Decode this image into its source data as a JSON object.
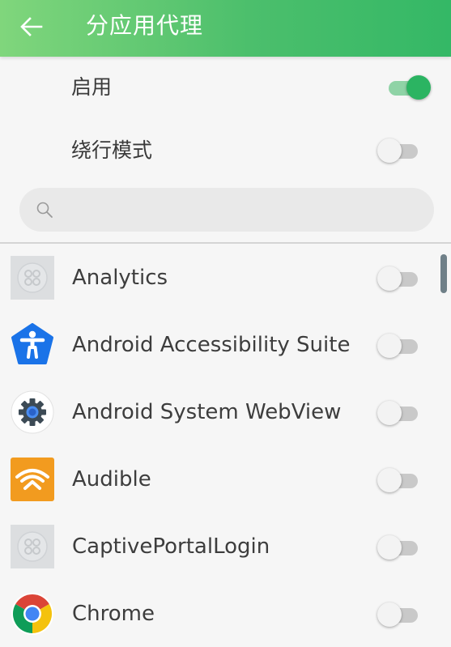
{
  "header": {
    "title": "分应用代理"
  },
  "settings": {
    "enable_label": "启用",
    "enable_on": true,
    "bypass_label": "绕行模式",
    "bypass_on": false
  },
  "search": {
    "placeholder": "",
    "value": ""
  },
  "apps": [
    {
      "name": "Analytics",
      "icon": "placeholder-app-icon",
      "enabled": false
    },
    {
      "name": "Android Accessibility Suite",
      "icon": "accessibility-icon",
      "enabled": false
    },
    {
      "name": "Android System WebView",
      "icon": "webview-gear-icon",
      "enabled": false
    },
    {
      "name": "Audible",
      "icon": "audible-icon",
      "enabled": false
    },
    {
      "name": "CaptivePortalLogin",
      "icon": "placeholder-app-icon",
      "enabled": false
    },
    {
      "name": "Chrome",
      "icon": "chrome-icon",
      "enabled": false
    }
  ],
  "colors": {
    "accent": "#2bb462",
    "header_start": "#80d67c",
    "header_end": "#34b866",
    "toggle_off_track": "#c9c9c9",
    "toggle_on_track": "#8fd3a6"
  }
}
